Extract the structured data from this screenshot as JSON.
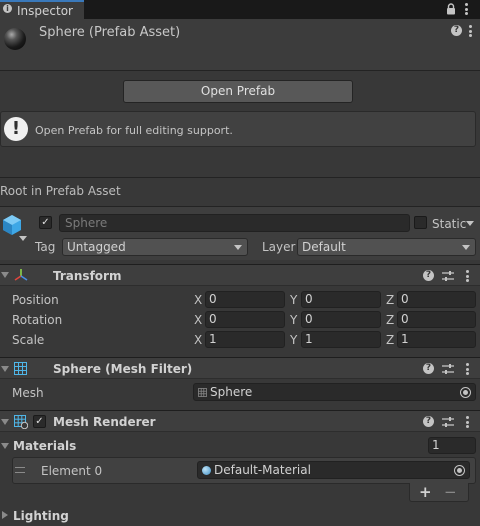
{
  "tab": {
    "label": "Inspector"
  },
  "header": {
    "title": "Sphere (Prefab Asset)"
  },
  "open_prefab_button": "Open Prefab",
  "helpbox": {
    "icon": "!",
    "text": "Open Prefab for full editing support."
  },
  "root_label": "Root in Prefab Asset",
  "gameobject": {
    "active": true,
    "name": "Sphere",
    "static_label": "Static",
    "static_checked": false,
    "tag_label": "Tag",
    "tag_value": "Untagged",
    "layer_label": "Layer",
    "layer_value": "Default"
  },
  "transform": {
    "title": "Transform",
    "rows": [
      {
        "label": "Position",
        "x": "0",
        "y": "0",
        "z": "0"
      },
      {
        "label": "Rotation",
        "x": "0",
        "y": "0",
        "z": "0"
      },
      {
        "label": "Scale",
        "x": "1",
        "y": "1",
        "z": "1"
      }
    ],
    "axes": [
      "X",
      "Y",
      "Z"
    ]
  },
  "mesh_filter": {
    "title": "Sphere (Mesh Filter)",
    "mesh_label": "Mesh",
    "mesh_value": "Sphere"
  },
  "mesh_renderer": {
    "title": "Mesh Renderer",
    "enabled": true,
    "materials_label": "Materials",
    "materials_count": "1",
    "element_label": "Element 0",
    "element_value": "Default-Material",
    "add_label": "+",
    "remove_label": "−",
    "lighting_label": "Lighting"
  },
  "colors": {
    "background": "#383838",
    "tab_accent": "#3a79bb",
    "field_bg": "#2a2a2a",
    "cube_icon": "#3ea7e6",
    "transform_icon_red": "#e0463e",
    "transform_icon_green": "#8ed64c",
    "transform_icon_blue": "#4a8de6"
  }
}
